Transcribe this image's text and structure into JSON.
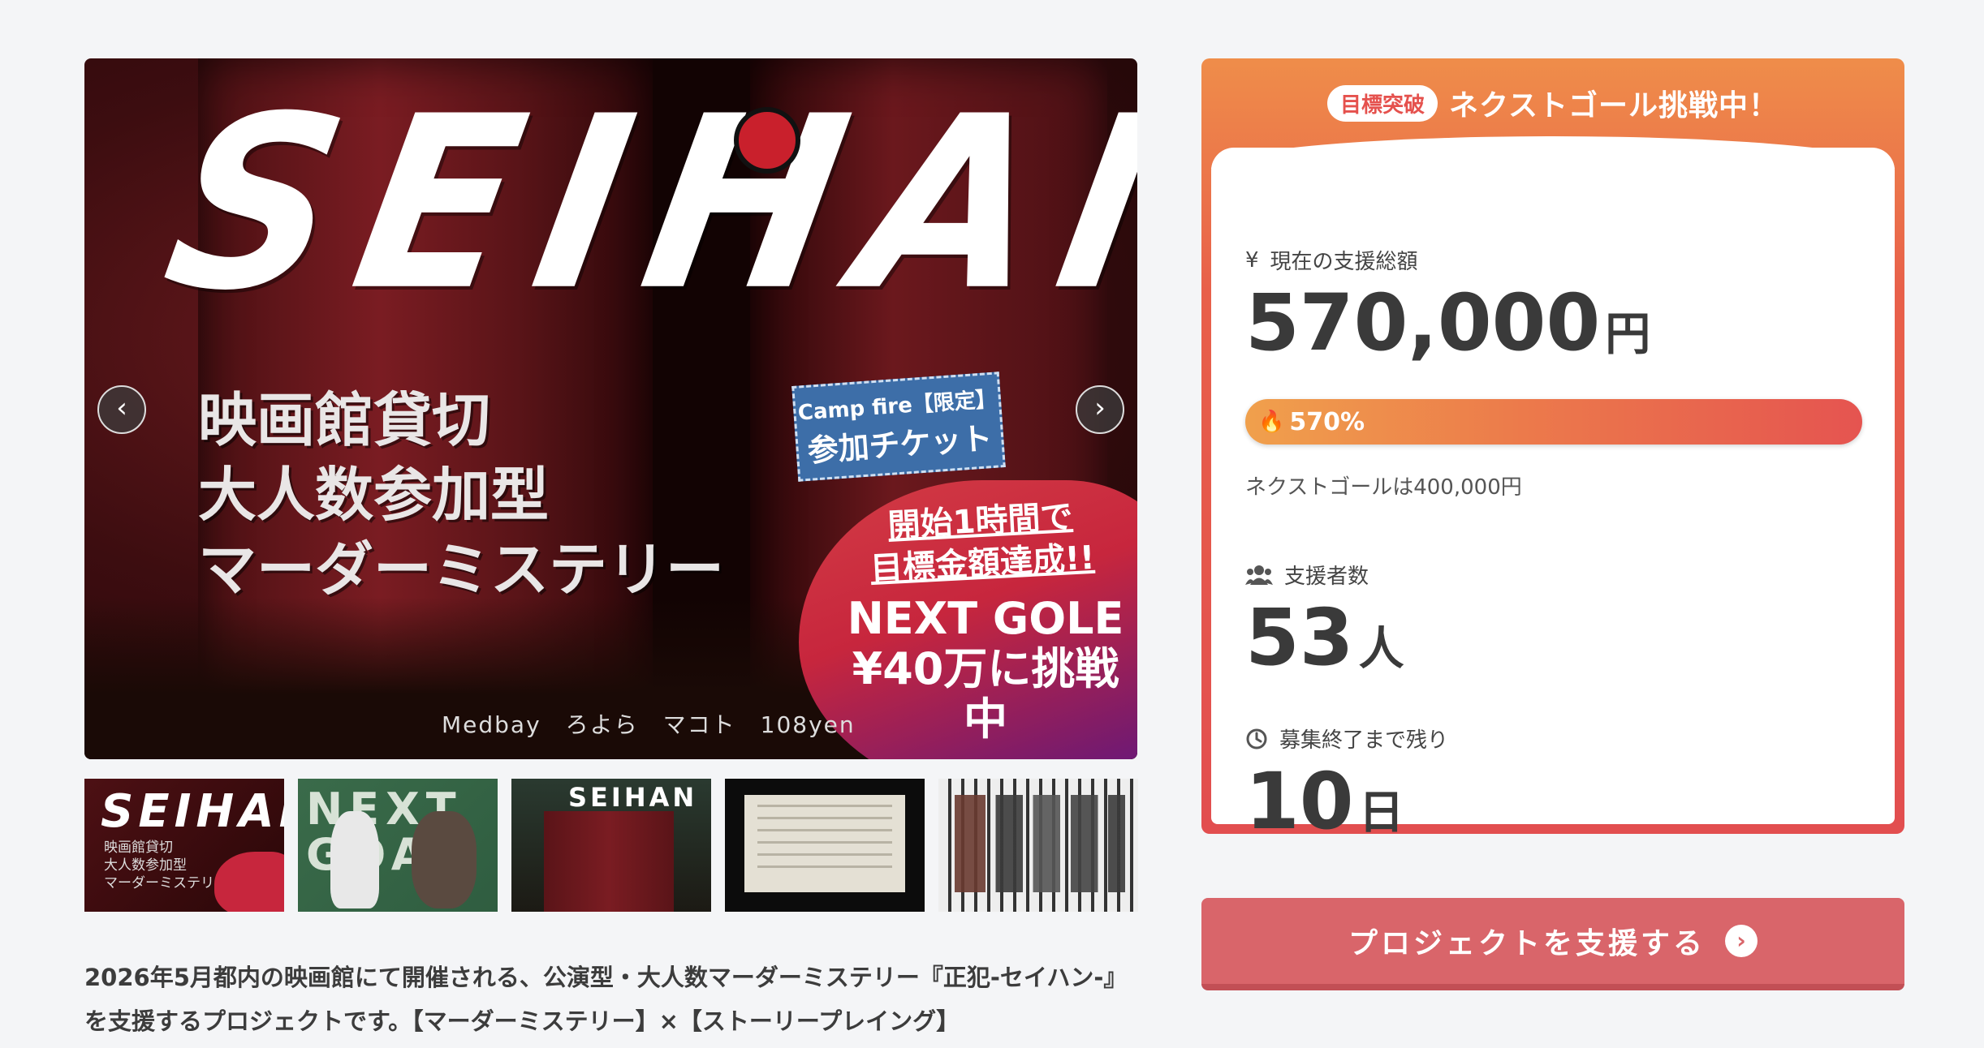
{
  "hero": {
    "logo_text": "SEIHAN",
    "title_lines": [
      "映画館貸切",
      "大人数参加型",
      "マーダーミステリー"
    ],
    "credits": "Medbay　ろよら　マコト　108yen",
    "tag_line1": "Camp fire【限定】",
    "tag_line2": "参加チケット",
    "blob_line1": "開始1時間で",
    "blob_line2": "目標金額達成!!",
    "blob_line3": "NEXT GOLE",
    "blob_line4": "¥40万に挑戦中"
  },
  "thumbs": {
    "t1_logo": "SEIHAN",
    "t1_jp": [
      "映画館貸切",
      "大人数参加型",
      "マーダーミステリー"
    ],
    "t2_text": "NEXT GOAL",
    "t3_logo": "SEIHAN"
  },
  "description": "2026年5月都内の映画館にて開催される、公演型・大人数マーダーミステリー『正犯-セイハン-』を支援するプロジェクトです。【マーダーミステリー】×【ストーリープレイング】",
  "card": {
    "badge": "目標突破",
    "headline": "ネクストゴール挑戦中！",
    "amount_label": "現在の支援総額",
    "amount_icon": "¥",
    "amount_value": "570,000",
    "amount_unit": "円",
    "progress_text": "570%",
    "progress_fraction": 1.0,
    "next_goal_text": "ネクストゴールは400,000円",
    "backers_label": "支援者数",
    "backers_value": "53",
    "backers_unit": "人",
    "remaining_label": "募集終了まで残り",
    "remaining_value": "10",
    "remaining_unit": "日"
  },
  "support_button": {
    "label": "プロジェクトを支援する",
    "icon": "chevron-right-circle-icon"
  },
  "colors": {
    "accent": "#e5514d",
    "button": "#d9656a",
    "background": "#f4f5f7"
  }
}
